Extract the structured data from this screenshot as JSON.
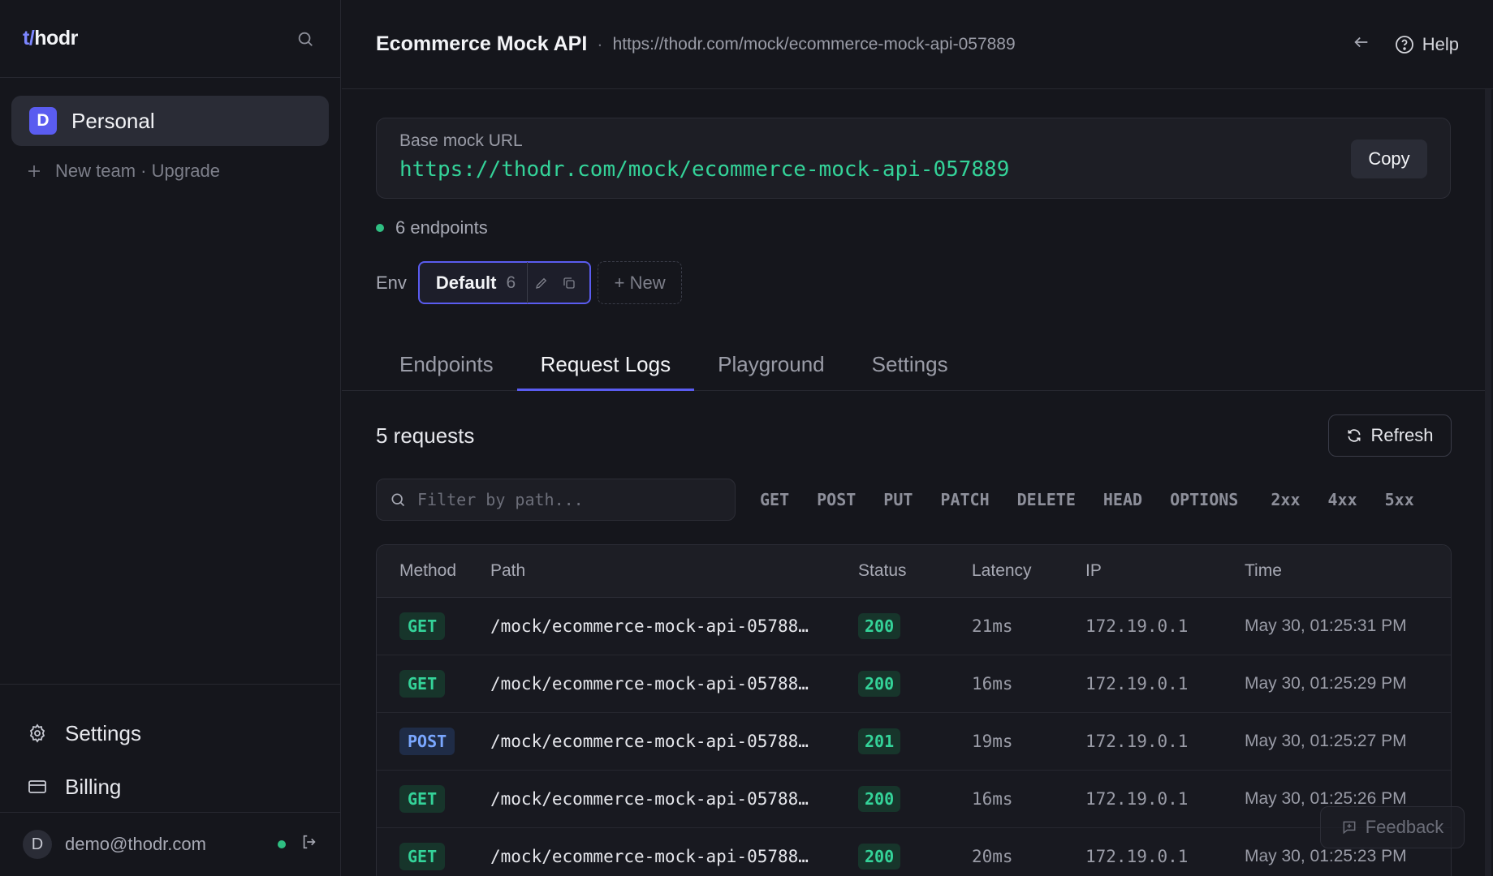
{
  "app": {
    "logo_t": "t/",
    "logo_rest": "hodr"
  },
  "sidebar": {
    "team_initial": "D",
    "team_name": "Personal",
    "new_team": "New team · Upgrade",
    "nav": [
      {
        "label": "Settings",
        "icon": "gear-icon"
      },
      {
        "label": "Billing",
        "icon": "card-icon"
      }
    ],
    "user_initial": "D",
    "user_email": "demo@thodr.com"
  },
  "header": {
    "title": "Ecommerce Mock API",
    "separator": "·",
    "url": "https://thodr.com/mock/ecommerce-mock-api-057889",
    "help": "Help"
  },
  "base_url": {
    "label": "Base mock URL",
    "value": "https://thodr.com/mock/ecommerce-mock-api-057889",
    "copy": "Copy"
  },
  "endpoints_summary": "6 endpoints",
  "env": {
    "label": "Env",
    "name": "Default",
    "count": "6",
    "new": "+ New"
  },
  "tabs": [
    {
      "label": "Endpoints",
      "active": false
    },
    {
      "label": "Request Logs",
      "active": true
    },
    {
      "label": "Playground",
      "active": false
    },
    {
      "label": "Settings",
      "active": false
    }
  ],
  "logs": {
    "count": "5 requests",
    "refresh": "Refresh",
    "filter_placeholder": "Filter by path...",
    "method_filters": [
      "GET",
      "POST",
      "PUT",
      "PATCH",
      "DELETE",
      "HEAD",
      "OPTIONS"
    ],
    "status_filters": [
      "2xx",
      "4xx",
      "5xx"
    ],
    "columns": [
      "Method",
      "Path",
      "Status",
      "Latency",
      "IP",
      "Time"
    ],
    "rows": [
      {
        "method": "GET",
        "path": "/mock/ecommerce-mock-api-05788…",
        "status": "200",
        "latency": "21ms",
        "ip": "172.19.0.1",
        "time": "May 30, 01:25:31 PM"
      },
      {
        "method": "GET",
        "path": "/mock/ecommerce-mock-api-05788…",
        "status": "200",
        "latency": "16ms",
        "ip": "172.19.0.1",
        "time": "May 30, 01:25:29 PM"
      },
      {
        "method": "POST",
        "path": "/mock/ecommerce-mock-api-05788…",
        "status": "201",
        "latency": "19ms",
        "ip": "172.19.0.1",
        "time": "May 30, 01:25:27 PM"
      },
      {
        "method": "GET",
        "path": "/mock/ecommerce-mock-api-05788…",
        "status": "200",
        "latency": "16ms",
        "ip": "172.19.0.1",
        "time": "May 30, 01:25:26 PM"
      },
      {
        "method": "GET",
        "path": "/mock/ecommerce-mock-api-05788…",
        "status": "200",
        "latency": "20ms",
        "ip": "172.19.0.1",
        "time": "May 30, 01:25:23 PM"
      }
    ]
  },
  "feedback": "Feedback",
  "colors": {
    "accent": "#5a5cf0",
    "success": "#34d399",
    "post": "#7aa7ff"
  }
}
